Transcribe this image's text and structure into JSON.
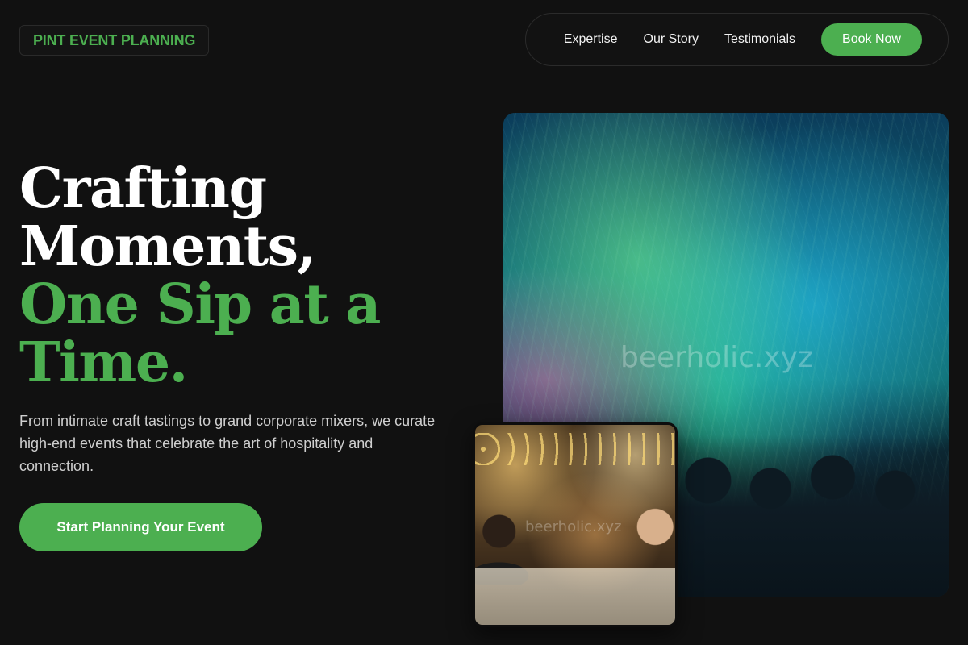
{
  "brand": {
    "name": "PINT EVENT PLANNING"
  },
  "nav": {
    "links": [
      "Expertise",
      "Our Story",
      "Testimonials"
    ],
    "cta": "Book Now"
  },
  "hero": {
    "title_line1": "Crafting",
    "title_line2": "Moments,",
    "title_line3": "One Sip at a",
    "title_line4": "Time.",
    "description": "From intimate craft tastings to grand corporate mixers, we curate high-end events that celebrate the art of hospitality and connection.",
    "cta": "Start Planning Your Event"
  },
  "images": {
    "main_watermark": "beerholic.xyz",
    "small_watermark": "beerholic.xyz"
  },
  "colors": {
    "accent": "#4caf50",
    "background": "#111111",
    "text": "#ffffff"
  }
}
